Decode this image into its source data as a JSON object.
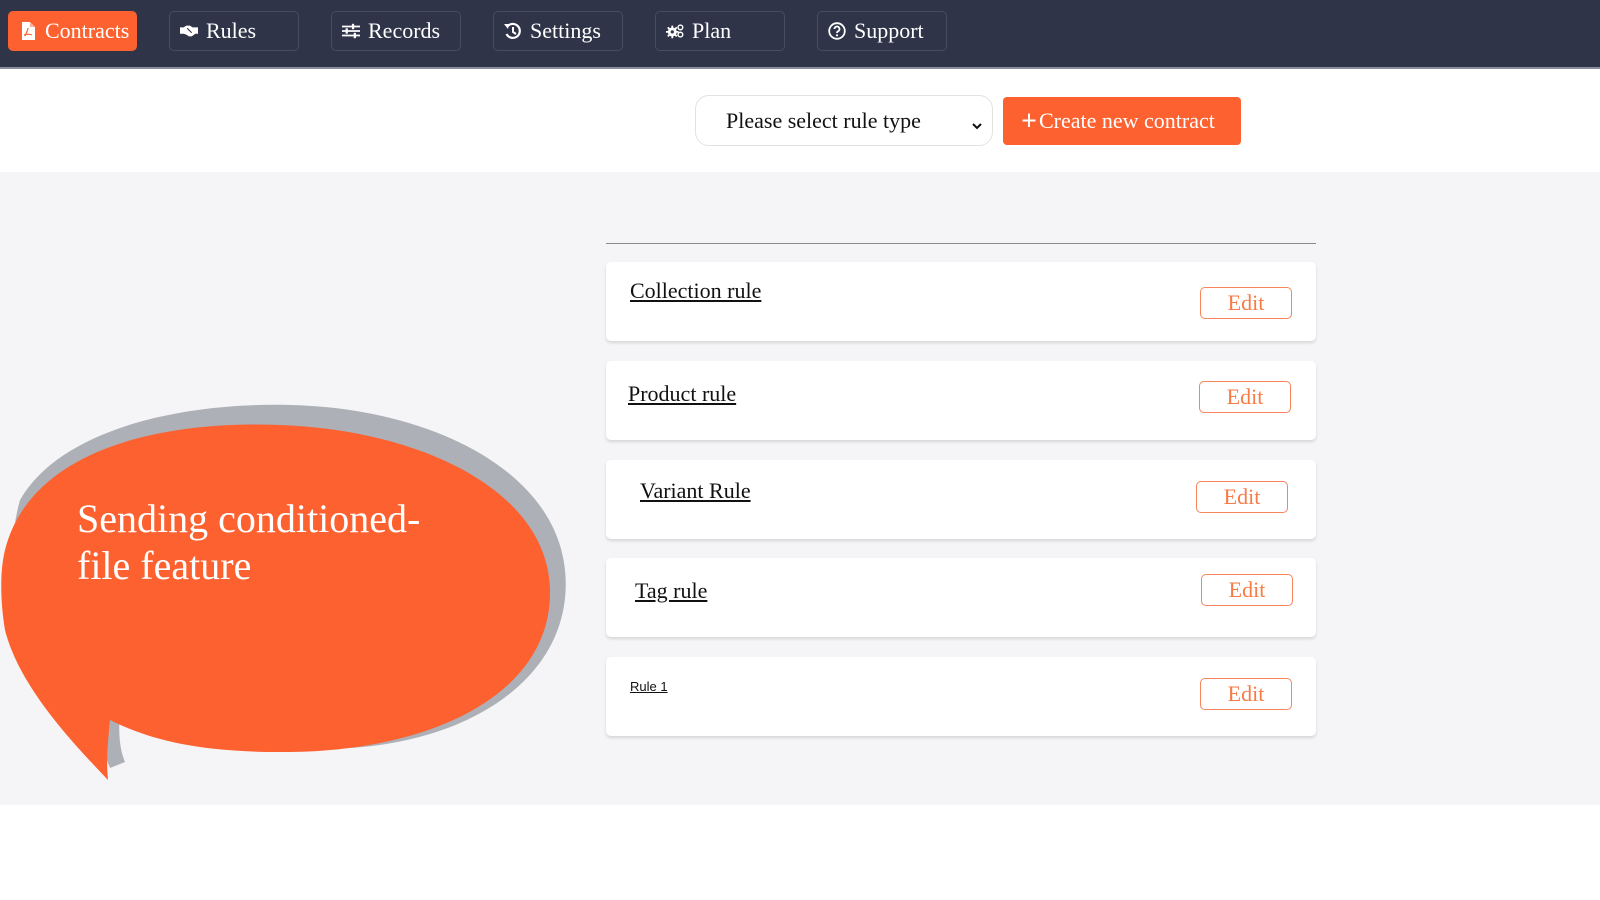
{
  "nav": {
    "items": [
      {
        "label": "Contracts",
        "icon": "file-pdf-icon",
        "active": true
      },
      {
        "label": "Rules",
        "icon": "handshake-icon",
        "active": false
      },
      {
        "label": "Records",
        "icon": "sliders-icon",
        "active": false
      },
      {
        "label": "Settings",
        "icon": "history-icon",
        "active": false
      },
      {
        "label": "Plan",
        "icon": "gears-icon",
        "active": false
      },
      {
        "label": "Support",
        "icon": "question-circle-icon",
        "active": false
      }
    ]
  },
  "toolbar": {
    "select_value": "Please select rule type",
    "create_button": "Create new contract",
    "create_icon": "plus-icon"
  },
  "rules": [
    {
      "name": "Collection rule",
      "edit": "Edit"
    },
    {
      "name": "Product rule",
      "edit": "Edit"
    },
    {
      "name": "Variant Rule",
      "edit": "Edit"
    },
    {
      "name": "Tag rule",
      "edit": "Edit"
    },
    {
      "name": "Rule 1",
      "edit": "Edit"
    }
  ],
  "callout": {
    "text": "Sending conditioned- file feature"
  },
  "colors": {
    "accent": "#fc612f",
    "nav_bg": "#2f3448",
    "content_bg": "#f5f5f7",
    "edit_border": "#f7845c",
    "bubble_shadow": "#aeb0b7"
  }
}
